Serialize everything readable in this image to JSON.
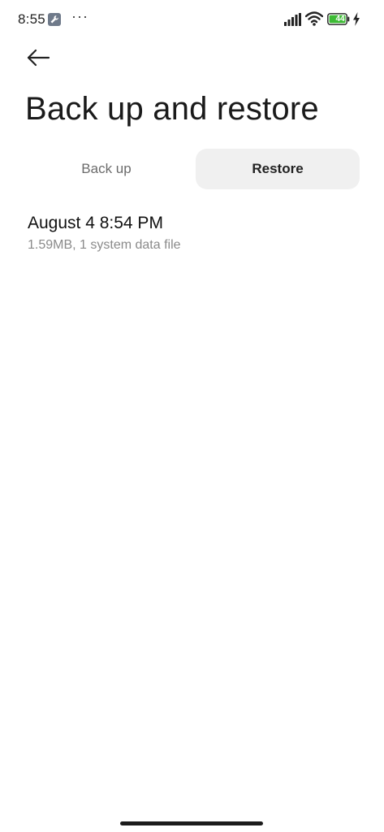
{
  "status_bar": {
    "time": "8:55",
    "more_indicator": "···",
    "battery_level": "44",
    "icons": [
      "wrench-icon",
      "signal-icon",
      "wifi-icon",
      "battery-icon",
      "charging-icon"
    ],
    "battery_color": "#3dbb35"
  },
  "header": {
    "back_icon": "arrow-left-icon",
    "title": "Back up and restore"
  },
  "tabs": [
    {
      "label": "Back up",
      "selected": false
    },
    {
      "label": "Restore",
      "selected": true
    }
  ],
  "backups": [
    {
      "title": "August 4 8:54 PM",
      "subtitle": "1.59MB, 1 system data file"
    }
  ],
  "colors": {
    "selected_tab_bg": "#f0f0f0",
    "subtitle_text": "#8a8a8a"
  }
}
